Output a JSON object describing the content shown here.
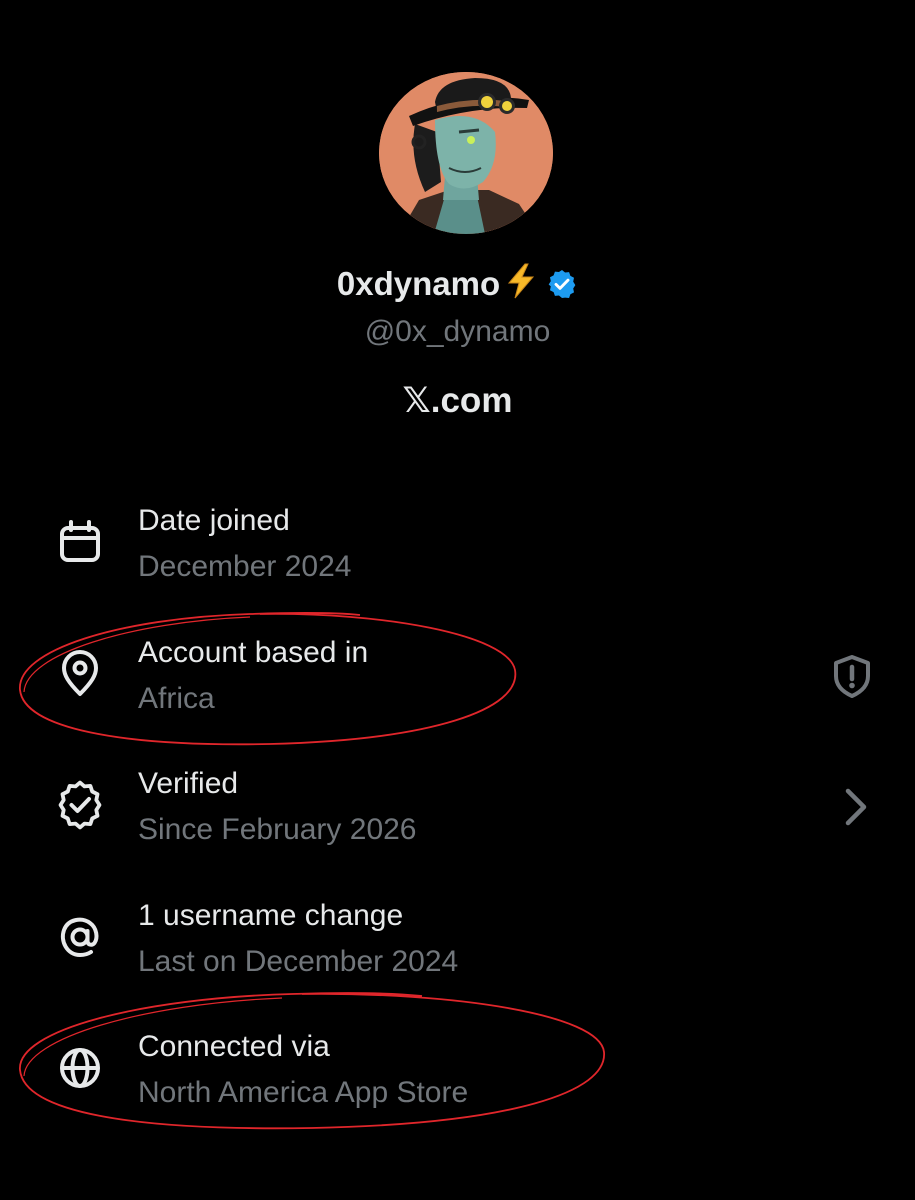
{
  "profile": {
    "display_name": "0xdynamo",
    "name_emoji": "⚡",
    "handle": "@0x_dynamo",
    "site": "𝕏.com"
  },
  "rows": [
    {
      "title": "Date joined",
      "value": "December 2024",
      "icon": "calendar-icon"
    },
    {
      "title": "Account based in",
      "value": "Africa",
      "icon": "location-pin-icon",
      "right_icon": "shield-alert-icon"
    },
    {
      "title": "Verified",
      "value": "Since February 2026",
      "icon": "verified-badge-icon",
      "right_icon": "chevron-right-icon"
    },
    {
      "title": "1 username change",
      "value": "Last on December 2024",
      "icon": "at-sign-icon"
    },
    {
      "title": "Connected via",
      "value": "North America App Store",
      "icon": "globe-icon"
    }
  ],
  "colors": {
    "background": "#000000",
    "primary_text": "#e7e9ea",
    "secondary_text": "#71767b",
    "verified_blue": "#1d9bf0",
    "annotation_red": "#e0262b",
    "avatar_bg": "#e08a66"
  }
}
